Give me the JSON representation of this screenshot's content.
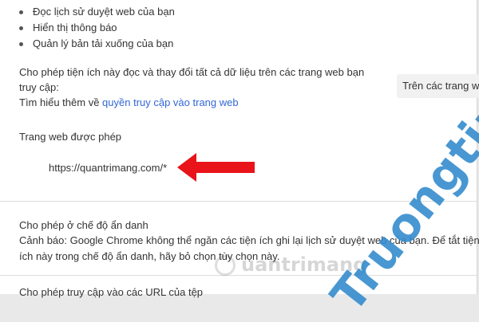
{
  "permissions": [
    "Đọc lịch sử duyệt web của bạn",
    "Hiển thị thông báo",
    "Quản lý bản tải xuống của bạn"
  ],
  "site_access": {
    "description_line1": "Cho phép tiện ích này đọc và thay đổi tất cả dữ liệu trên các trang web bạn",
    "description_line2": "truy cập:",
    "learn_more_prefix": "Tìm hiểu thêm về ",
    "learn_more_link": "quyền truy cập vào trang web",
    "dropdown_value": "Trên các trang web"
  },
  "allowed_sites": {
    "heading": "Trang web được phép",
    "site": "https://quantrimang.com/*"
  },
  "incognito": {
    "heading": "Cho phép ở chế độ ẩn danh",
    "warning_line1": "Cảnh báo: Google Chrome không thể ngăn các tiện ích ghi lại lịch sử duyệt web của bạn. Để tắt tiện",
    "warning_line2": "ích này trong chế độ ẩn danh, hãy bỏ chọn tùy chọn này."
  },
  "file_urls": {
    "heading": "Cho phép truy cập vào các URL của tệp"
  },
  "watermarks": {
    "side": "Truongtin.top",
    "bottom": "uantrimang"
  },
  "colors": {
    "link": "#3367d6",
    "arrow": "#e8141a",
    "watermark": "#348ccd"
  }
}
